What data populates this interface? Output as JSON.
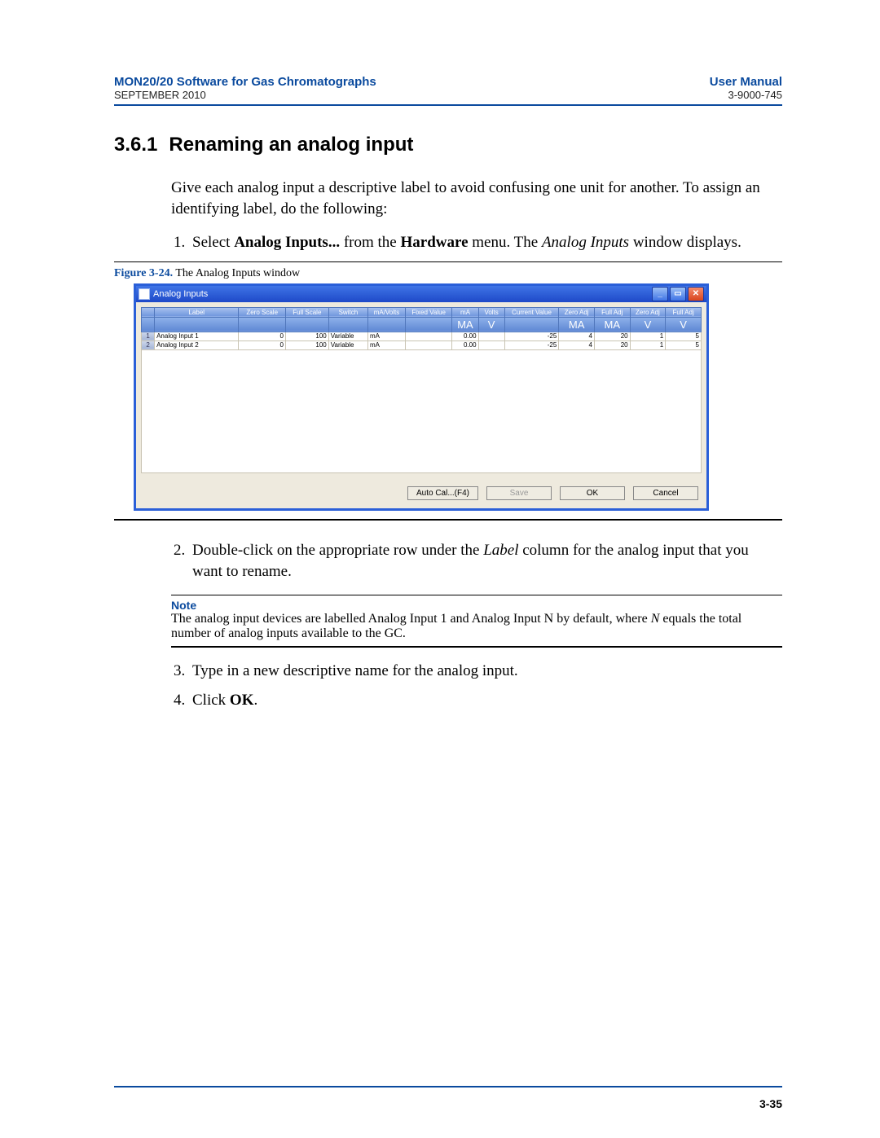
{
  "header": {
    "brand": "MON20/20 Software for Gas Chromatographs",
    "date": "SEPTEMBER 2010",
    "manual": "User Manual",
    "docnum": "3-9000-745"
  },
  "section": {
    "num": "3.6.1",
    "title": "Renaming an analog input"
  },
  "intro": "Give each analog input a descriptive label to avoid confusing one unit for another.  To assign an identifying label, do the following:",
  "step1": {
    "pre": "Select ",
    "b1": "Analog Inputs...",
    "mid": " from the ",
    "b2": "Hardware",
    "mid2": " menu.  The ",
    "it": "Analog Inputs",
    "post": " window displays."
  },
  "figcap": {
    "label": "Figure 3-24.",
    "text": "  The Analog Inputs window"
  },
  "win": {
    "title": "Analog Inputs",
    "headers": [
      "",
      "Label",
      "Zero Scale",
      "Full Scale",
      "Switch",
      "mA/Volts",
      "Fixed Value",
      "mA",
      "Volts",
      "Current Value",
      "Zero Adj",
      "Full Adj",
      "Zero Adj",
      "Full Adj"
    ],
    "sub": [
      "",
      "",
      "",
      "",
      "",
      "",
      "",
      "MA",
      "V",
      "",
      "MA",
      "MA",
      "V",
      "V"
    ],
    "rows": [
      {
        "n": "1",
        "label": "Analog Input 1",
        "zero": "0",
        "full": "100",
        "switch": "Variable",
        "mav": "mA",
        "fixed": "",
        "ma": "0.00",
        "v": "",
        "cur": "-25",
        "za": "4",
        "fa": "20",
        "zav": "1",
        "fav": "5"
      },
      {
        "n": "2",
        "label": "Analog Input 2",
        "zero": "0",
        "full": "100",
        "switch": "Variable",
        "mav": "mA",
        "fixed": "",
        "ma": "0.00",
        "v": "",
        "cur": "-25",
        "za": "4",
        "fa": "20",
        "zav": "1",
        "fav": "5"
      }
    ],
    "buttons": {
      "autocal": "Auto Cal...(F4)",
      "save": "Save",
      "ok": "OK",
      "cancel": "Cancel"
    }
  },
  "step2": {
    "pre": "Double-click on the appropriate row under the ",
    "it": "Label",
    "post": " column for the analog input that you want to rename."
  },
  "note": {
    "label": "Note",
    "text_a": "The analog input devices are labelled Analog Input 1 and Analog Input N by default, where ",
    "it": "N",
    "text_b": " equals the total number of analog inputs available to the GC."
  },
  "step3": "Type in a new descriptive name for the analog input.",
  "step4": {
    "pre": "Click ",
    "b": "OK",
    "post": "."
  },
  "pagenum": "3-35"
}
